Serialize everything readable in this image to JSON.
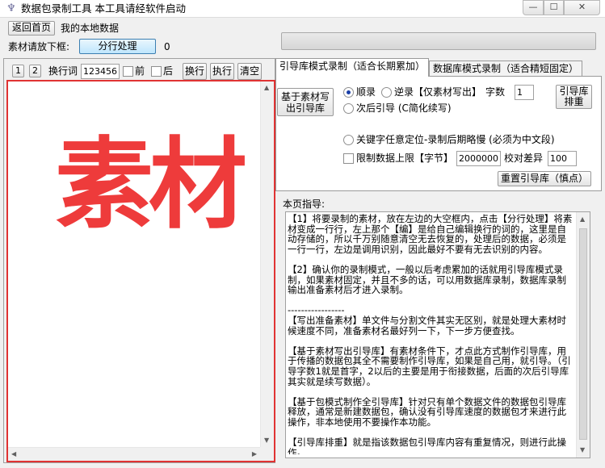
{
  "window": {
    "title": "数据包录制工具   本工具请经软件启动",
    "minimize": "—",
    "maximize": "☐",
    "close": "✕"
  },
  "nav": {
    "home_button": "返回首页",
    "local_data_label": "我的本地数据",
    "material_label": "素材请放下框:",
    "split_button": "分行处理",
    "split_count": "0"
  },
  "progress": {
    "value": 0
  },
  "editor_toolbar": {
    "btn_1": "1",
    "btn_2": "2",
    "newline_label": "换行词",
    "newline_value": "123456",
    "before_label": "前",
    "after_label": "后",
    "newline_button": "换行",
    "run_button": "执行",
    "clear_button": "清空"
  },
  "editor": {
    "content": "素材"
  },
  "tabs": [
    {
      "label": "引导库模式录制（适合长期累加）"
    },
    {
      "label": "数据库模式录制（适合精短固定）"
    }
  ],
  "tab_panel": {
    "write_button": "基于素材写出引导库",
    "order_forward": "顺录",
    "order_reverse": "逆录【仅素材写出】",
    "count_label": "字数",
    "count_value": "1",
    "sort_button": "引导库排重",
    "secondary_guide": "次后引导 (C简化续写)",
    "keyword_locate": "关键字任意定位-录制后期略慢 (必须为中文段)",
    "limit_label": "限制数据上限【字节】",
    "limit_value": "2000000",
    "diff_label": "校对差异",
    "diff_value": "100",
    "reset_button": "重置引导库（慎点）"
  },
  "guide": {
    "title": "本页指导:",
    "text": "【1】将要录制的素材，放在左边的大空框内，点击【分行处理】将素材变成一行行，左上那个【编】是给自己编辑换行的词的，这里是自动存储的，所以千万别随意清空无去恢复的，处理后的数据，必须是一行一行，左边是调用识别，因此最好不要有无去识别的内容。\n\n【2】确认你的录制模式，一般以后考虑累加的话就用引导库模式录制，如果素材固定，并且不多的话，可以用数据库录制，数据库录制输出准备素材后才进入录制。\n\n-----------------\n【写出准备素材】单文件与分割文件其实无区别，就是处理大素材时候速度不同，准备素材名最好列一下，下一步方便查找。\n\n【基于素材写出引导库】有素材条件下，才点此方式制作引导库，用于传播的数据包其全不需要制作引导库，如果是自己用，就引导。（引导字数1就是首字，2以后的主要是用于衔接数据，后面的次后引导库其实就是续写数据）。\n\n【基于包模式制作全引导库】针对只有单个数据文件的数据包引导库释放，通常是新建数据包，确认没有引导库速度的数据包才来进行此操作，非本地使用不要操作本功能。\n\n【引导库排重】就是指该数据包引导库内容有重复情况，则进行此操作。"
  },
  "colors": {
    "accent_red": "#e03333",
    "progress_green": "#06b025",
    "radio_dot": "#1a3fa8"
  }
}
